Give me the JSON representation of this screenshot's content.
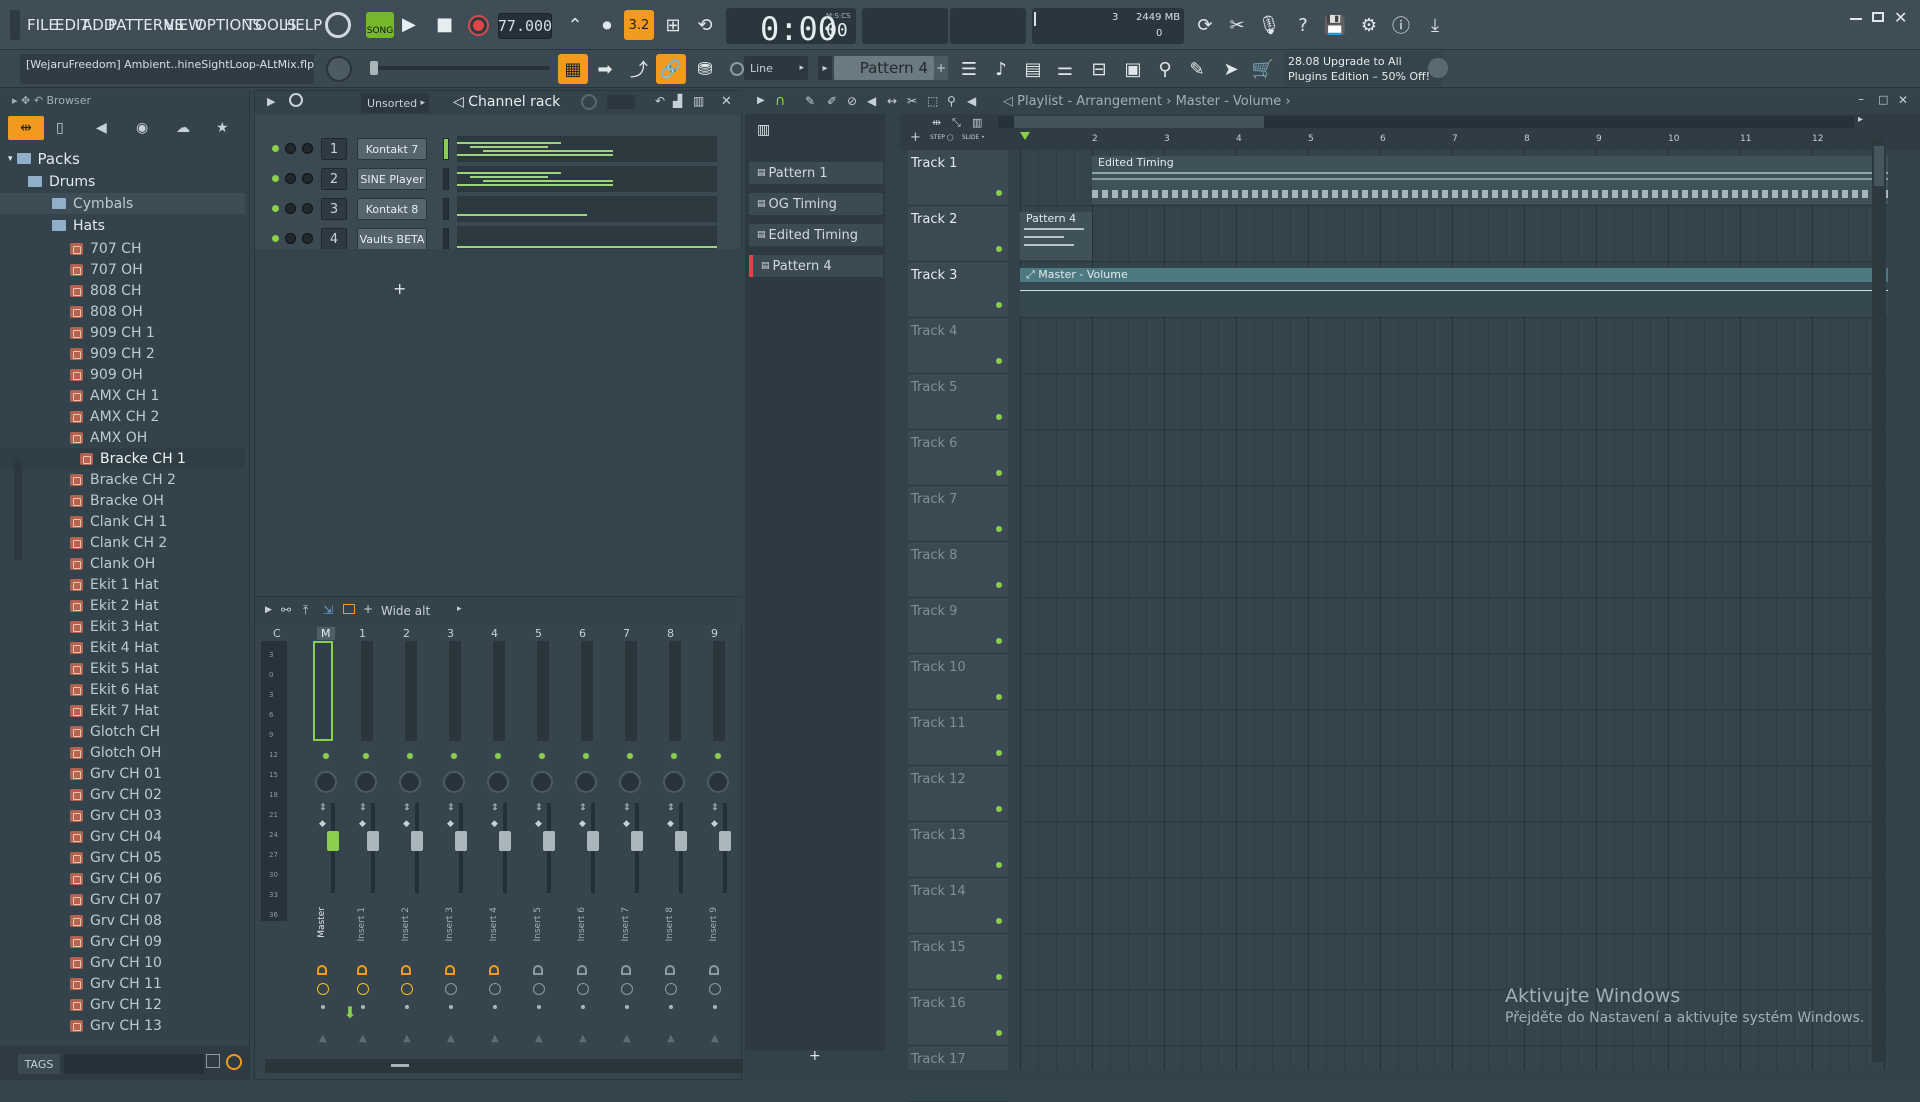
{
  "menu": [
    "FILE",
    "EDIT",
    "ADD",
    "PATTERNS",
    "VIEW",
    "OPTIONS",
    "TOOLS",
    "HELP"
  ],
  "transport": {
    "mode": "SONG",
    "tempo": "77.000",
    "time": "0:00",
    "time_sub": "00",
    "time_label": "M:S:CS",
    "step_label": "3.2"
  },
  "cpu": {
    "voices": "3",
    "memory": "2449 MB",
    "second": "0"
  },
  "project_hint": "[WejaruFreedom] Ambient..hineSightLoop-ALtMix.flp",
  "snap": "Line",
  "pattern_selector": "Pattern 4",
  "promo": {
    "line1": "28.08  Upgrade to All",
    "line2": "Plugins Edition – 50% Off!"
  },
  "browser": {
    "title": "Browser",
    "root": "Packs",
    "folder1": "Drums",
    "folder2": "Cymbals",
    "folder3": "Hats",
    "items": [
      "707 CH",
      "707 OH",
      "808 CH",
      "808 OH",
      "909 CH 1",
      "909 CH 2",
      "909 OH",
      "AMX CH 1",
      "AMX CH 2",
      "AMX OH",
      "Bracke CH 1",
      "Bracke CH 2",
      "Bracke OH",
      "Clank CH 1",
      "Clank CH 2",
      "Clank OH",
      "Ekit 1 Hat",
      "Ekit 2 Hat",
      "Ekit 3 Hat",
      "Ekit 4 Hat",
      "Ekit 5 Hat",
      "Ekit 6 Hat",
      "Ekit 7 Hat",
      "Glotch CH",
      "Glotch OH",
      "Grv CH 01",
      "Grv CH 02",
      "Grv CH 03",
      "Grv CH 04",
      "Grv CH 05",
      "Grv CH 06",
      "Grv CH 07",
      "Grv CH 08",
      "Grv CH 09",
      "Grv CH 10",
      "Grv CH 11",
      "Grv CH 12",
      "Grv CH 13"
    ],
    "tags": "TAGS"
  },
  "channel_rack": {
    "filter": "Unsorted",
    "title": "Channel rack",
    "channels": [
      {
        "num": "1",
        "name": "Kontakt 7"
      },
      {
        "num": "2",
        "name": "SINE Player"
      },
      {
        "num": "3",
        "name": "Kontakt 8"
      },
      {
        "num": "4",
        "name": "Vaults BETA"
      }
    ],
    "add": "+"
  },
  "mixer": {
    "preset": "Wide alt",
    "header": [
      "C",
      "M",
      "1",
      "2",
      "3",
      "4",
      "5",
      "6",
      "7",
      "8",
      "9"
    ],
    "scale": [
      "3",
      "0",
      "3",
      "6",
      "9",
      "12",
      "15",
      "18",
      "21",
      "24",
      "27",
      "30",
      "33",
      "36"
    ],
    "strips": [
      "Master",
      "Insert 1",
      "Insert 2",
      "Insert 3",
      "Insert 4",
      "Insert 5",
      "Insert 6",
      "Insert 7",
      "Insert 8",
      "Insert 9"
    ]
  },
  "playlist": {
    "breadcrumb": "Playlist - Arrangement › Master - Volume ›",
    "patterns": [
      "Pattern 1",
      "OG Timing",
      "Edited Timing",
      "Pattern 4"
    ],
    "tracks": [
      "Track 1",
      "Track 2",
      "Track 3",
      "Track 4",
      "Track 5",
      "Track 6",
      "Track 7",
      "Track 8",
      "Track 9",
      "Track 10",
      "Track 11",
      "Track 12",
      "Track 13",
      "Track 14",
      "Track 15",
      "Track 16",
      "Track 17"
    ],
    "bars": [
      "2",
      "3",
      "4",
      "5",
      "6",
      "7",
      "8",
      "9",
      "10",
      "11",
      "12"
    ],
    "clips": {
      "edited": "Edited Timing",
      "pattern4": "Pattern 4",
      "automation": "Master - Volume"
    },
    "step": "STEP",
    "slide": "SLIDE",
    "add": "+"
  },
  "watermark": {
    "title": "Aktivujte Windows",
    "sub": "Přejděte do Nastavení a aktivujte systém Windows."
  },
  "colors": {
    "accent": "#f29a1e",
    "green": "#8ad04a",
    "clip": "#4c7a80"
  }
}
